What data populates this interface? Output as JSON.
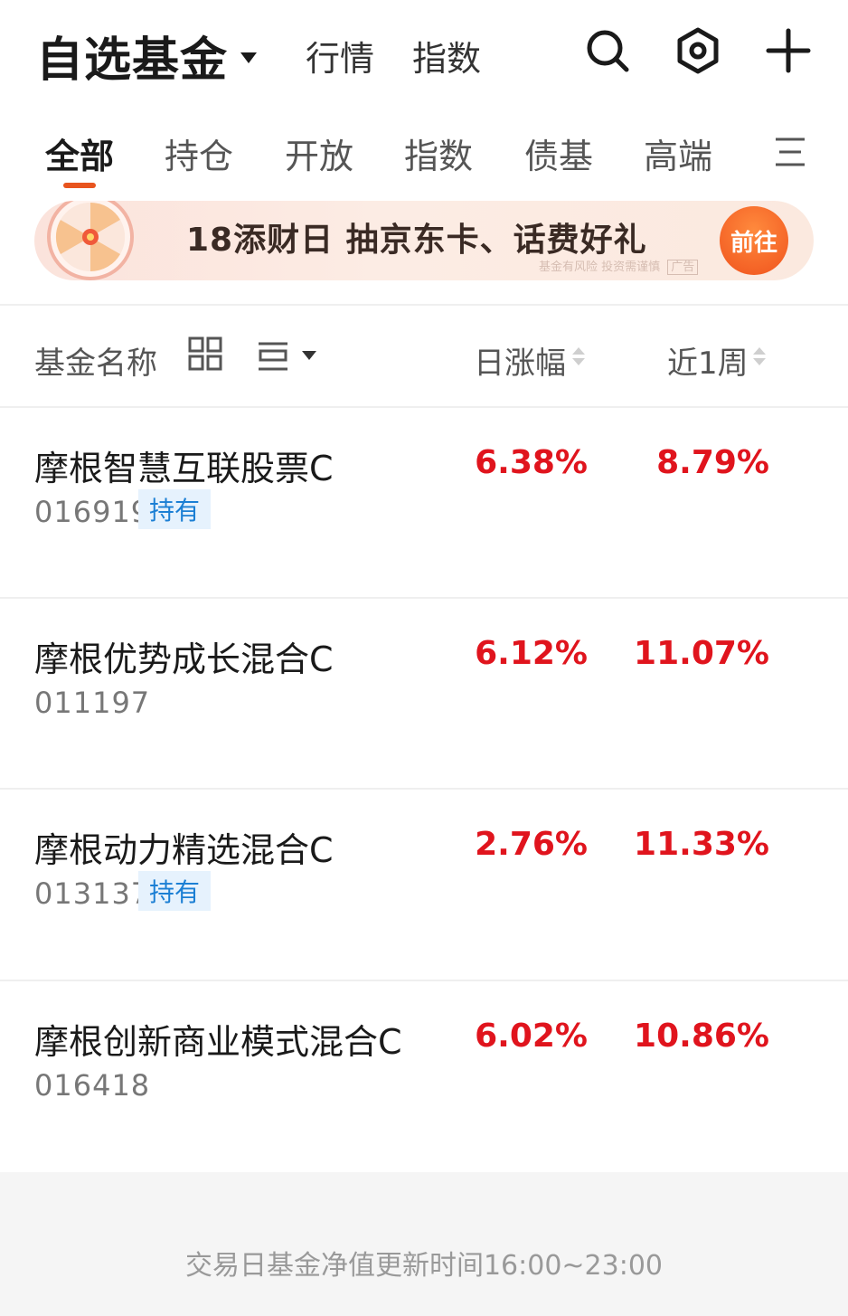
{
  "header": {
    "title": "自选基金",
    "nav": [
      "行情",
      "指数"
    ],
    "icons": [
      "search-icon",
      "settings-hex-icon",
      "plus-icon"
    ]
  },
  "tabs": {
    "items": [
      "全部",
      "持仓",
      "开放",
      "指数",
      "债基",
      "高端"
    ],
    "active_index": 0,
    "accent": "#e8541e"
  },
  "banner": {
    "text": "18添财日 抽京东卡、话费好礼",
    "disclaimer": "基金有风险 投资需谨慎",
    "ad_label": "广告",
    "button": "前往"
  },
  "columns": {
    "name": "基金名称",
    "daily": "日涨幅",
    "weekly": "近1周"
  },
  "funds": [
    {
      "name": "摩根智慧互联股票C",
      "code": "016919",
      "tag": "持有",
      "daily": "6.38%",
      "weekly": "8.79%"
    },
    {
      "name": "摩根优势成长混合C",
      "code": "011197",
      "tag": "",
      "daily": "6.12%",
      "weekly": "11.07%"
    },
    {
      "name": "摩根动力精选混合C",
      "code": "013137",
      "tag": "持有",
      "daily": "2.76%",
      "weekly": "11.33%"
    },
    {
      "name": "摩根创新商业模式混合C",
      "code": "016418",
      "tag": "",
      "daily": "6.02%",
      "weekly": "10.86%"
    }
  ],
  "colors": {
    "up": "#e0141d",
    "tag_bg": "#e6f2fd",
    "tag_text": "#1b7fd4"
  },
  "footer": {
    "text": "交易日基金净值更新时间16:00~23:00"
  }
}
